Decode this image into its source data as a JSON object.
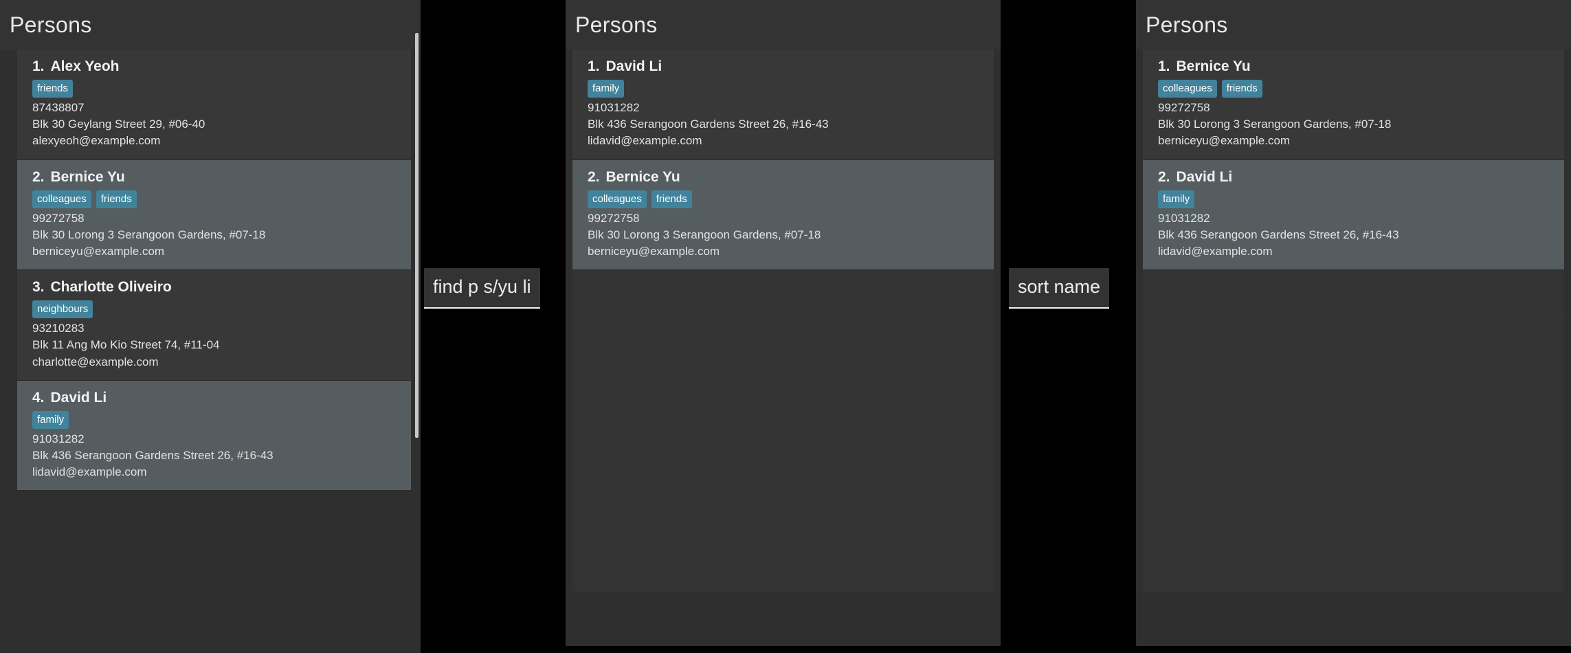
{
  "app": {
    "background_color": "#000000",
    "accent_tag_color": "#42839c",
    "panel_color": "#2f2f2f",
    "card_color": "#383838",
    "card_selected_color": "#555d60"
  },
  "panels": [
    {
      "id": "all-persons",
      "title": "Persons",
      "scrollbar": {
        "visible": true,
        "thumb_top_pct": 5,
        "thumb_height_pct": 62
      },
      "persons": [
        {
          "index": "1.",
          "name": "Alex Yeoh",
          "tags": [
            "friends"
          ],
          "phone": "87438807",
          "address": "Blk 30 Geylang Street 29, #06-40",
          "email": "alexyeoh@example.com",
          "selected": false
        },
        {
          "index": "2.",
          "name": "Bernice Yu",
          "tags": [
            "colleagues",
            "friends"
          ],
          "phone": "99272758",
          "address": "Blk 30 Lorong 3 Serangoon Gardens, #07-18",
          "email": "berniceyu@example.com",
          "selected": true
        },
        {
          "index": "3.",
          "name": "Charlotte Oliveiro",
          "tags": [
            "neighbours"
          ],
          "phone": "93210283",
          "address": "Blk 11 Ang Mo Kio Street 74, #11-04",
          "email": "charlotte@example.com",
          "selected": false
        },
        {
          "index": "4.",
          "name": "David Li",
          "tags": [
            "family"
          ],
          "phone": "91031282",
          "address": "Blk 436 Serangoon Gardens Street 26, #16-43",
          "email": "lidavid@example.com",
          "selected": true
        }
      ]
    },
    {
      "id": "find-result",
      "title": "Persons",
      "scrollbar": {
        "visible": false
      },
      "persons": [
        {
          "index": "1.",
          "name": "David Li",
          "tags": [
            "family"
          ],
          "phone": "91031282",
          "address": "Blk 436 Serangoon Gardens Street 26, #16-43",
          "email": "lidavid@example.com",
          "selected": false
        },
        {
          "index": "2.",
          "name": "Bernice Yu",
          "tags": [
            "colleagues",
            "friends"
          ],
          "phone": "99272758",
          "address": "Blk 30 Lorong 3 Serangoon Gardens, #07-18",
          "email": "berniceyu@example.com",
          "selected": true
        }
      ],
      "empty_rows": 4
    },
    {
      "id": "sorted-result",
      "title": "Persons",
      "scrollbar": {
        "visible": false
      },
      "persons": [
        {
          "index": "1.",
          "name": "Bernice Yu",
          "tags": [
            "colleagues",
            "friends"
          ],
          "phone": "99272758",
          "address": "Blk 30 Lorong 3 Serangoon Gardens, #07-18",
          "email": "berniceyu@example.com",
          "selected": false
        },
        {
          "index": "2.",
          "name": "David Li",
          "tags": [
            "family"
          ],
          "phone": "91031282",
          "address": "Blk 436 Serangoon Gardens Street 26, #16-43",
          "email": "lidavid@example.com",
          "selected": true
        }
      ],
      "empty_rows": 4
    }
  ],
  "commands": [
    {
      "id": "find-command",
      "text": "find p s/yu li"
    },
    {
      "id": "sort-command",
      "text": "sort name"
    }
  ]
}
